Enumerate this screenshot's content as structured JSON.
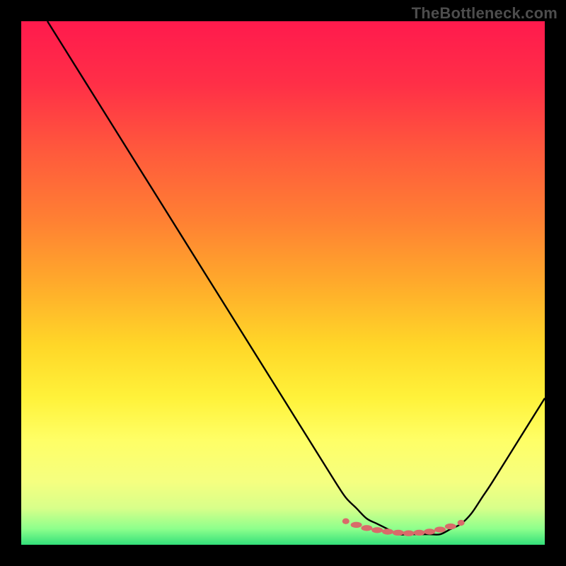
{
  "watermark": "TheBottleneck.com",
  "chart_data": {
    "type": "line",
    "title": "",
    "xlabel": "",
    "ylabel": "",
    "xlim": [
      0,
      100
    ],
    "ylim": [
      0,
      100
    ],
    "grid": false,
    "legend": null,
    "series": [
      {
        "name": "bottleneck-curve",
        "color": "#000000",
        "x": [
          5,
          10,
          15,
          20,
          25,
          30,
          35,
          40,
          45,
          50,
          55,
          60,
          62,
          64,
          66,
          68,
          70,
          72,
          74,
          76,
          78,
          80,
          82,
          84,
          86,
          88,
          90,
          95,
          100
        ],
        "y": [
          100,
          92,
          84,
          76,
          68,
          60,
          52,
          44,
          36,
          28,
          20,
          12,
          9,
          7,
          5,
          4,
          3,
          2,
          2,
          2,
          2,
          2,
          3,
          4,
          6,
          9,
          12,
          20,
          28
        ]
      }
    ],
    "markers": {
      "name": "optimal-zone-markers",
      "color": "#d96a6a",
      "x": [
        62,
        64,
        66,
        68,
        70,
        72,
        74,
        76,
        78,
        80,
        82,
        84
      ],
      "y": [
        4.5,
        3.8,
        3.2,
        2.8,
        2.5,
        2.3,
        2.2,
        2.3,
        2.5,
        2.9,
        3.5,
        4.2
      ]
    },
    "gradient_stops": [
      {
        "offset": 0.0,
        "color": "#ff1a4d"
      },
      {
        "offset": 0.12,
        "color": "#ff2f47"
      },
      {
        "offset": 0.25,
        "color": "#ff5a3c"
      },
      {
        "offset": 0.38,
        "color": "#ff8033"
      },
      {
        "offset": 0.5,
        "color": "#ffaa2b"
      },
      {
        "offset": 0.62,
        "color": "#ffd728"
      },
      {
        "offset": 0.72,
        "color": "#fff23a"
      },
      {
        "offset": 0.8,
        "color": "#ffff66"
      },
      {
        "offset": 0.88,
        "color": "#f5ff80"
      },
      {
        "offset": 0.93,
        "color": "#d8ff8a"
      },
      {
        "offset": 0.97,
        "color": "#8cff8c"
      },
      {
        "offset": 1.0,
        "color": "#33e07a"
      }
    ]
  }
}
